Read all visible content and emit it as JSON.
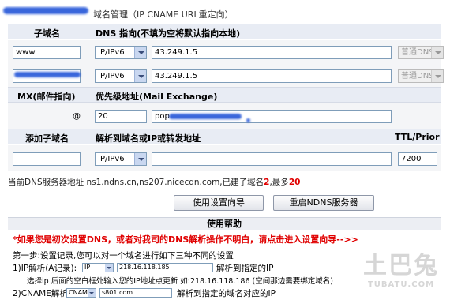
{
  "header": {
    "title": "域名管理（IP CNAME URL重定向）"
  },
  "columns": {
    "subdomain": "子域名",
    "dns_target": "DNS 指向(不填为空将默认指向本地)",
    "mx": "MX(邮件指向)",
    "priority_addr": "优先级地址(Mail Exchange)",
    "add_subdomain": "添加子域名",
    "resolve_target": "解析到域名或IP或转发地址",
    "ttl": "TTL/Prior"
  },
  "records": [
    {
      "name": "www",
      "type": "IP/IPv6",
      "value": "43.249.1.5",
      "line": "普通DNS"
    },
    {
      "name": "",
      "type": "IP/IPv6",
      "value": "43.249.1.5",
      "line": "普通DNS"
    }
  ],
  "mx_record": {
    "at": "@",
    "priority": "20",
    "host": "pop."
  },
  "new_record": {
    "name": "",
    "type": "IP/IPv6",
    "value": "",
    "ttl": "7200"
  },
  "dns_info": {
    "prefix": "当前DNS服务器地址",
    "servers": "ns1.ndns.cn,ns207.nicecdn.com,已建子域名",
    "built_count": "2",
    "max_label": ",最多",
    "max_count": "20"
  },
  "buttons": {
    "setup_wizard": "使用设置向导",
    "restart": "重启NDNS服务器"
  },
  "help": {
    "title": "使用帮助",
    "warning": "*如果您是初次设置DNS，或者对我司的DNS解析操作不明白，请点击进入设置向导-->>",
    "step1": "第一步:设置记录,您可以对一个域名进行如下三种不同的设置",
    "ip_label": "1)IP解析(A记录):",
    "ip_type": "IP",
    "ip_value": "218.16.118.185",
    "ip_desc": "解析到指定的IP",
    "ip_note": "选择ip 后面的空白框处输入您的IP地址点更新  如:218.16.118.186 (空间那边需要绑定域名)",
    "cname_label": "2)CNAME解析:",
    "cname_type": "CNAME",
    "cname_value": "s801.com",
    "cname_desc": "解析到指定的域名对应的IP"
  },
  "watermark": {
    "big": "土巴兔",
    "small": "TUBATU.COM"
  }
}
